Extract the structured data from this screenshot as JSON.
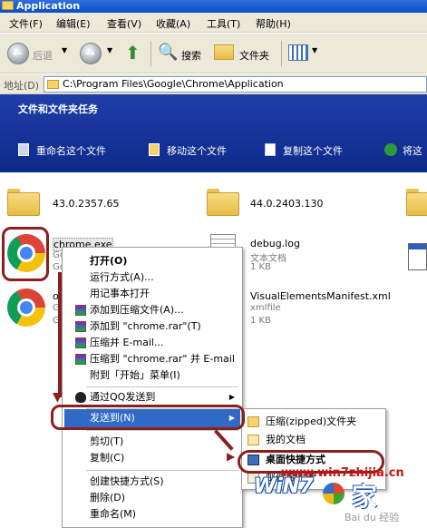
{
  "window": {
    "title": "Application"
  },
  "menubar": [
    "文件(F)",
    "编辑(E)",
    "查看(V)",
    "收藏(A)",
    "工具(T)",
    "帮助(H)"
  ],
  "toolbar": {
    "back": "后退",
    "search": "搜索",
    "folders": "文件夹"
  },
  "address": {
    "label": "地址(D)",
    "path": "C:\\Program Files\\Google\\Chrome\\Application"
  },
  "taskpane": {
    "title": "文件和文件夹任务",
    "items": [
      "重命名这个文件",
      "移动这个文件",
      "复制这个文件",
      "将这"
    ]
  },
  "files": {
    "folder1": "43.0.2357.65",
    "folder2": "44.0.2403.130",
    "chrome1": {
      "name": "chrome.exe",
      "sub1": "Google Ch",
      "sub2": "Goo"
    },
    "chrome2": {
      "name": "old_",
      "sub1": "Goo",
      "sub2": "Goo"
    },
    "debug": {
      "name": "debug.log",
      "type": "文本文档",
      "size": "1 KB"
    },
    "manifest": {
      "name": "VisualElementsManifest.xml",
      "type": "xmlfile",
      "size": "1 KB"
    }
  },
  "context_menu": {
    "open": "打开(O)",
    "run_as": "运行方式(A)...",
    "notepad": "用记事本打开",
    "add_archive": "添加到压缩文件(A)...",
    "add_rar": "添加到 \"chrome.rar\"(T)",
    "compress_email": "压缩并 E-mail...",
    "compress_rar_email": "压缩到 \"chrome.rar\" 并 E-mail",
    "pin_start": "附到「开始」菜单(I)",
    "qq_send": "通过QQ发送到",
    "send_to": "发送到(N)",
    "cut": "剪切(T)",
    "copy": "复制(C)",
    "create_shortcut": "创建快捷方式(S)",
    "delete": "删除(D)",
    "rename": "重命名(M)"
  },
  "submenu": {
    "zip": "压缩(zipped)文件夹",
    "my_docs": "我的文档",
    "desktop": "桌面快捷方式",
    "mail": "邮件接收者"
  },
  "watermark": {
    "logo": "WiN7",
    "url": "www.win7zhijia.cn",
    "char": "家",
    "baidu": "Bai du 经验"
  },
  "colors": {
    "annotation": "#8b1e1e",
    "highlight": "#316ac5",
    "taskpane": "#1f3ea8"
  }
}
